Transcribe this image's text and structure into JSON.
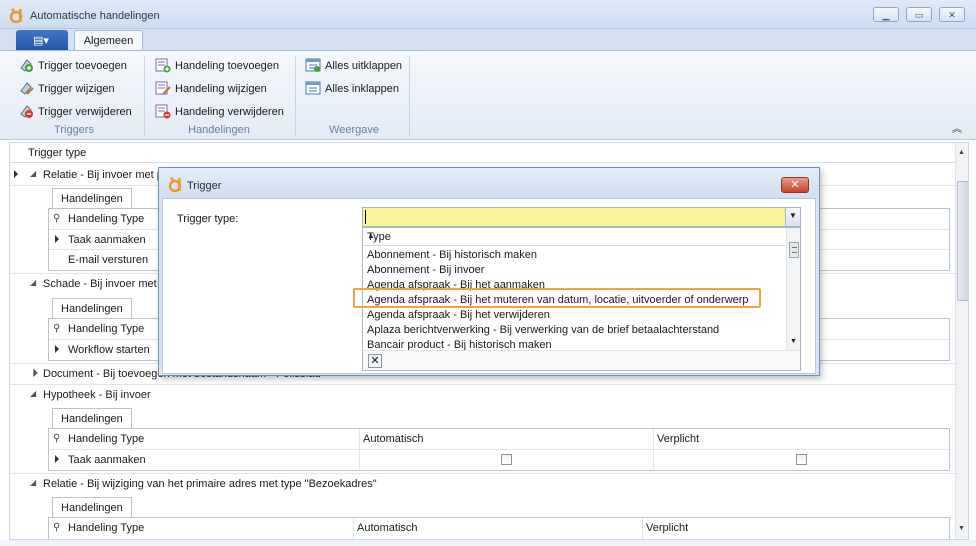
{
  "window": {
    "title": "Automatische handelingen"
  },
  "ribbon": {
    "tab": "Algemeen",
    "groups": [
      {
        "label": "Triggers",
        "items": [
          "Trigger toevoegen",
          "Trigger wijzigen",
          "Trigger verwijderen"
        ]
      },
      {
        "label": "Handelingen",
        "items": [
          "Handeling toevoegen",
          "Handeling wijzigen",
          "Handeling verwijderen"
        ]
      },
      {
        "label": "Weergave",
        "items": [
          "Alles uitklappen",
          "Alles inklappen"
        ]
      }
    ]
  },
  "grid": {
    "column_header": "Trigger type",
    "rows": {
      "relatie1": "Relatie - Bij invoer met p",
      "handelingen_tab": "Handelingen",
      "handeling_type": "Handeling Type",
      "taak_aanmaken": "Taak aanmaken",
      "email_versturen": "E-mail versturen",
      "schade": "Schade - Bij invoer met",
      "workflow_starten": "Workflow starten",
      "document": "Document - Bij toevoegen met bestandsnaam - Polisblad",
      "hypotheek": "Hypotheek - Bij invoer",
      "automatisch": "Automatisch",
      "verplicht": "Verplicht",
      "relatie2": "Relatie - Bij wijziging van het primaire adres met type \"Bezoekadres\""
    }
  },
  "dialog": {
    "title": "Trigger",
    "field_label": "Trigger type:",
    "combo_value": "",
    "dropdown_header": "Type",
    "options": [
      "Abonnement - Bij historisch maken",
      "Abonnement - Bij invoer",
      "Agenda afspraak - Bij het aanmaken",
      "Agenda afspraak - Bij het muteren van datum, locatie, uitvoerder of onderwerp",
      "Agenda afspraak - Bij het verwijderen",
      "Aplaza berichtverwerking - Bij verwerking van de brief betaalachterstand",
      "Bancair product - Bij historisch maken"
    ],
    "highlighted_option": "Agenda afspraak - Bij het muteren van datum, locatie, uitvoerder of onderwerp"
  },
  "colors": {
    "accent_orange": "#f2a33a",
    "combo_yellow": "#fbf29a",
    "ribbon_blue": "#1f56a6"
  },
  "icons": [
    "app-logo-icon",
    "minimize-icon",
    "maximize-icon",
    "close-icon",
    "add-trigger-icon",
    "edit-trigger-icon",
    "remove-trigger-icon",
    "add-action-icon",
    "edit-action-icon",
    "remove-action-icon",
    "expand-all-icon",
    "collapse-all-icon"
  ]
}
